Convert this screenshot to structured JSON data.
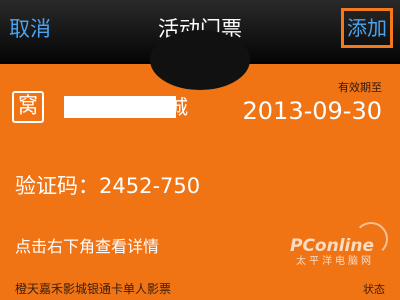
{
  "navbar": {
    "cancel_label": "取消",
    "title": "活动门票",
    "add_label": "添加"
  },
  "ticket": {
    "logo_glyph": "窝",
    "cinema_name_visible": "城",
    "expiry_label": "有效期至",
    "expiry_date": "2013-09-30",
    "code_label": "验证码：",
    "code_value": "2452-750",
    "hint": "点击右下角查看详情",
    "ticket_name": "橙天嘉禾影城银通卡单人影票",
    "status_label": "状态"
  },
  "watermark": {
    "main": "PConline",
    "sub": "太平洋电脑网"
  },
  "colors": {
    "ticket_orange": "#f07314",
    "nav_blue": "#4aa3f0",
    "highlight_border": "#f4791c"
  }
}
